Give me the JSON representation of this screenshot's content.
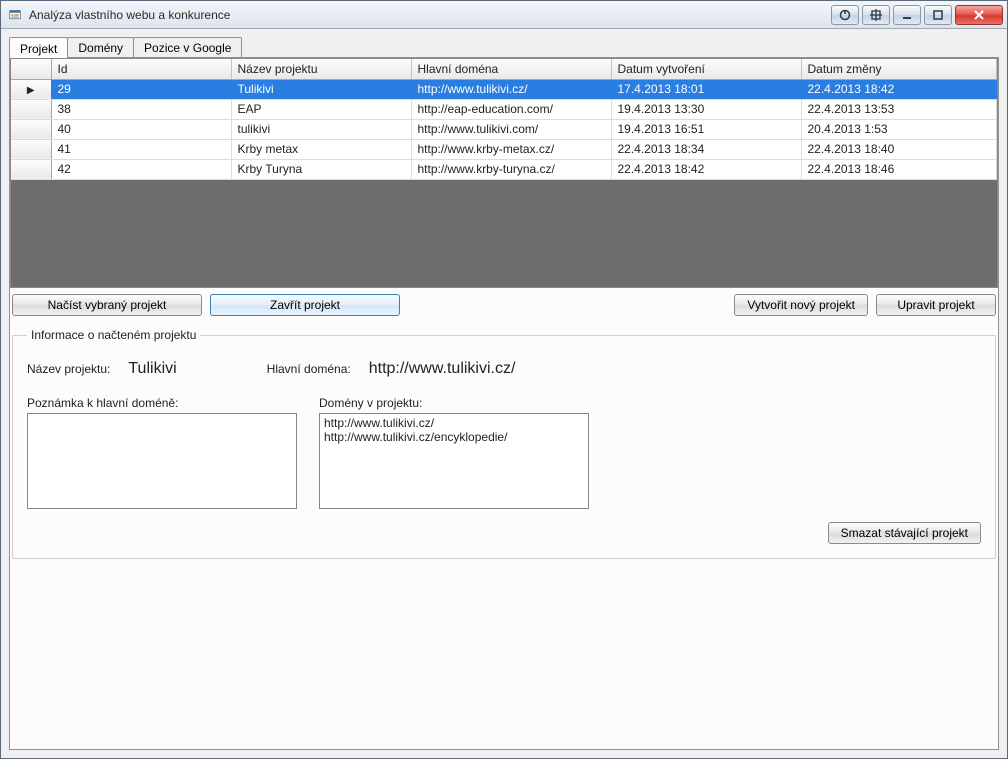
{
  "window": {
    "title": "Analýza vlastního webu a konkurence"
  },
  "tabs": [
    {
      "label": "Projekt"
    },
    {
      "label": "Domény"
    },
    {
      "label": "Pozice v Google"
    }
  ],
  "active_tab_index": 0,
  "grid": {
    "columns": [
      {
        "header": "Id"
      },
      {
        "header": "Název projektu"
      },
      {
        "header": "Hlavní doména"
      },
      {
        "header": "Datum vytvoření"
      },
      {
        "header": "Datum změny"
      }
    ],
    "rows": [
      {
        "selected": true,
        "id": "29",
        "name": "Tulikivi",
        "domain": "http://www.tulikivi.cz/",
        "created": "17.4.2013 18:01",
        "changed": "22.4.2013 18:42"
      },
      {
        "selected": false,
        "id": "38",
        "name": "EAP",
        "domain": "http://eap-education.com/",
        "created": "19.4.2013 13:30",
        "changed": "22.4.2013 13:53"
      },
      {
        "selected": false,
        "id": "40",
        "name": "tulikivi",
        "domain": "http://www.tulikivi.com/",
        "created": "19.4.2013 16:51",
        "changed": "20.4.2013 1:53"
      },
      {
        "selected": false,
        "id": "41",
        "name": "Krby metax",
        "domain": "http://www.krby-metax.cz/",
        "created": "22.4.2013 18:34",
        "changed": "22.4.2013 18:40"
      },
      {
        "selected": false,
        "id": "42",
        "name": "Krby Turyna",
        "domain": "http://www.krby-turyna.cz/",
        "created": "22.4.2013 18:42",
        "changed": "22.4.2013 18:46"
      }
    ]
  },
  "buttons": {
    "load": "Načíst vybraný projekt",
    "close": "Zavřít projekt",
    "new": "Vytvořit nový projekt",
    "edit": "Upravit projekt",
    "delete": "Smazat stávající projekt"
  },
  "info": {
    "group_title": "Informace o načteném projektu",
    "name_label": "Název projektu:",
    "name_value": "Tulikivi",
    "domain_label": "Hlavní doména:",
    "domain_value": "http://www.tulikivi.cz/",
    "note_label": "Poznámka k hlavní doméně:",
    "note_value": "",
    "domains_label": "Domény v projektu:",
    "domains_list": [
      "http://www.tulikivi.cz/",
      "http://www.tulikivi.cz/encyklopedie/"
    ]
  }
}
